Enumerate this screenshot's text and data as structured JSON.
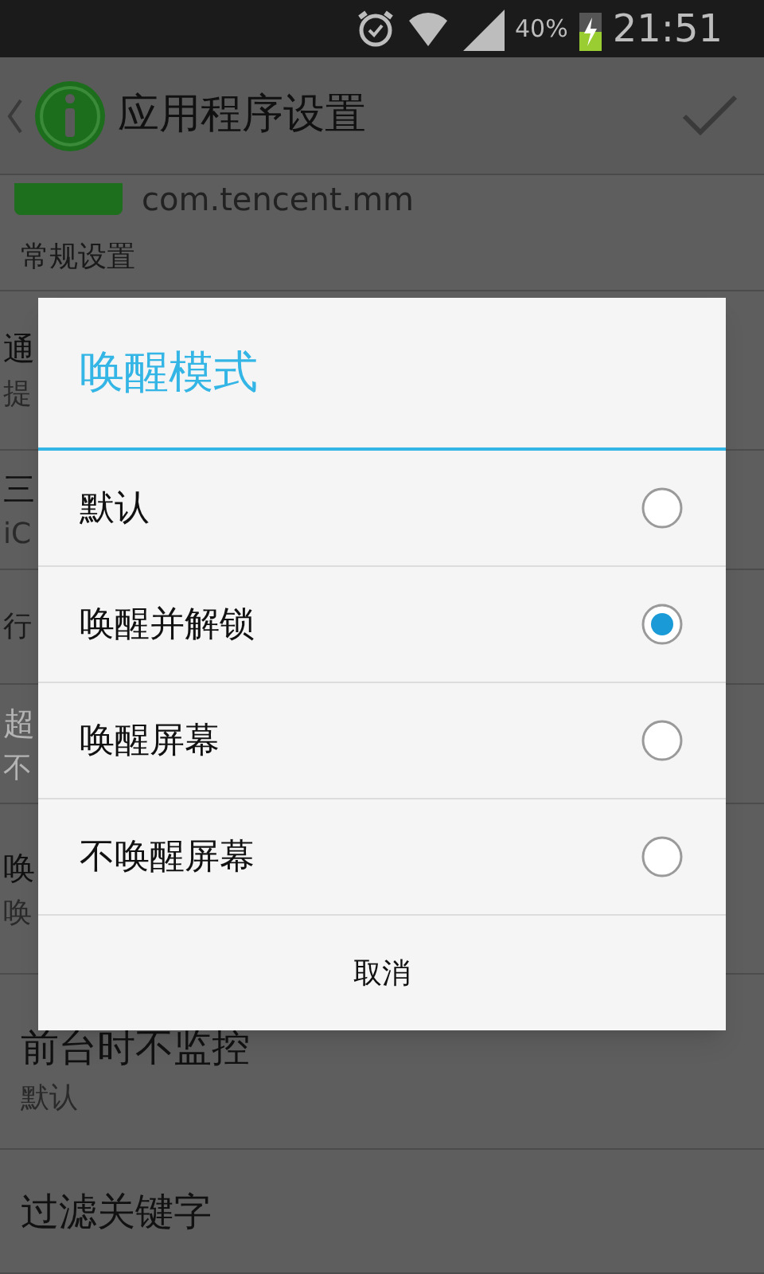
{
  "status_bar": {
    "battery": "40%",
    "time": "21:51"
  },
  "header": {
    "title": "应用程序设置"
  },
  "app_row": {
    "package": "com.tencent.mm"
  },
  "sections": [
    {
      "header": "常规设置",
      "rows": [
        {
          "title": "通",
          "subtitle": "提",
          "disabled": false
        },
        {
          "title": "三",
          "subtitle": "iC",
          "disabled": false
        }
      ]
    },
    {
      "header": "行",
      "rows": [
        {
          "title": "超",
          "subtitle": "不",
          "disabled": true
        },
        {
          "title": "唤",
          "subtitle": "唤",
          "disabled": false
        },
        {
          "title": "前台时不监控",
          "subtitle": "默认",
          "disabled": false
        },
        {
          "title": "过滤关键字",
          "disabled": false
        }
      ]
    }
  ],
  "dialog": {
    "title": "唤醒模式",
    "options": [
      {
        "label": "默认",
        "selected": false
      },
      {
        "label": "唤醒并解锁",
        "selected": true
      },
      {
        "label": "唤醒屏幕",
        "selected": false
      },
      {
        "label": "不唤醒屏幕",
        "selected": false
      }
    ],
    "cancel": "取消"
  }
}
